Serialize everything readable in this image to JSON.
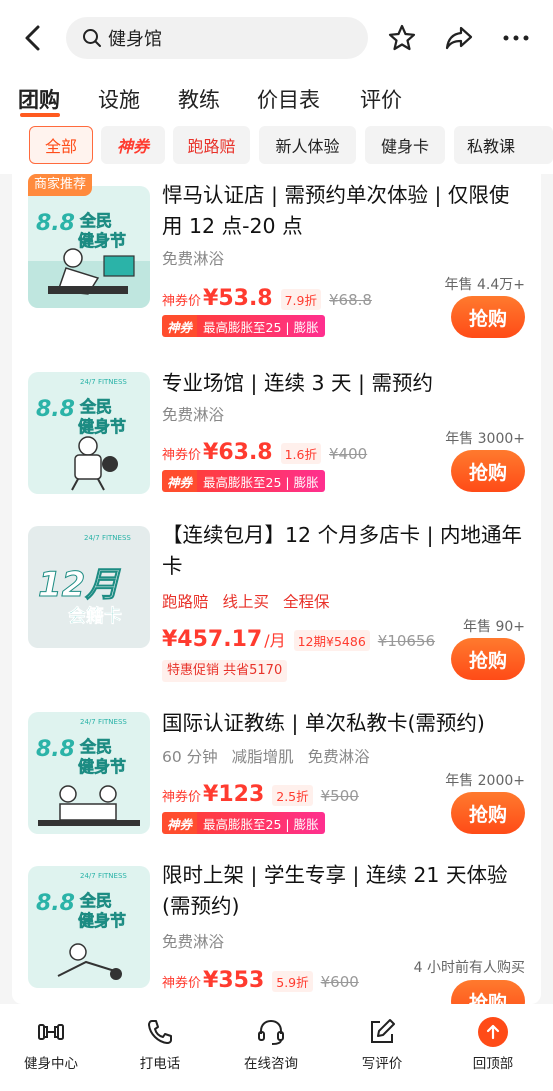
{
  "search": {
    "query": "健身馆"
  },
  "tabs": [
    {
      "label": "团购"
    },
    {
      "label": "设施"
    },
    {
      "label": "教练"
    },
    {
      "label": "价目表"
    },
    {
      "label": "评价"
    }
  ],
  "chips": [
    {
      "label": "全部"
    },
    {
      "label": "神券"
    },
    {
      "label": "跑路赔"
    },
    {
      "label": "新人体验"
    },
    {
      "label": "健身卡"
    },
    {
      "label": "私教课"
    }
  ],
  "items": [
    {
      "badge": "商家推荐",
      "title": "悍马认证店 | 需预约单次体验 | 仅限使用 12 点-20 点",
      "tags": [
        "免费淋浴"
      ],
      "price_label": "神券价",
      "price": "¥53.8",
      "discount": "7.9折",
      "original": "¥68.8",
      "promo_tag": "神券",
      "promo_text": "最高膨胀至25 | 膨胀",
      "sold": "年售 4.4万+",
      "buy": "抢购",
      "poster": {
        "top": "8.8",
        "line1": "全民",
        "line2": "健身节"
      }
    },
    {
      "title": "专业场馆 | 连续 3 天 | 需预约",
      "tags": [
        "免费淋浴"
      ],
      "price_label": "神券价",
      "price": "¥63.8",
      "discount": "1.6折",
      "original": "¥400",
      "promo_tag": "神券",
      "promo_text": "最高膨胀至25 | 膨胀",
      "sold": "年售 3000+",
      "buy": "抢购",
      "poster": {
        "brand": "24/7 FITNESS",
        "top": "8.8",
        "line1": "全民",
        "line2": "健身节"
      }
    },
    {
      "title": "【连续包月】12 个月多店卡 | 内地通年卡",
      "tags": [
        "跑路赔",
        "线上买",
        "全程保"
      ],
      "price": "¥457.17",
      "unit": "/月",
      "discount": "12期¥5486",
      "original": "¥10656",
      "promo_text": "特惠促销  共省5170",
      "sold": "年售 90+",
      "buy": "抢购",
      "poster": {
        "brand": "24/7 FITNESS",
        "top": "12月",
        "line1": "会籍卡"
      }
    },
    {
      "title": "国际认证教练 | 单次私教卡(需预约)",
      "tags": [
        "60 分钟",
        "减脂增肌",
        "免费淋浴"
      ],
      "price_label": "神券价",
      "price": "¥123",
      "discount": "2.5折",
      "original": "¥500",
      "promo_tag": "神券",
      "promo_text": "最高膨胀至25 | 膨胀",
      "sold": "年售 2000+",
      "buy": "抢购",
      "poster": {
        "brand": "24/7 FITNESS",
        "top": "8.8",
        "line1": "全民",
        "line2": "健身节"
      }
    },
    {
      "title": "限时上架 | 学生专享 | 连续 21 天体验(需预约)",
      "tags": [
        "免费淋浴"
      ],
      "price_label": "神券价",
      "price": "¥353",
      "discount": "5.9折",
      "original": "¥600",
      "sold": "4 小时前有人购买",
      "buy": "抢购",
      "poster": {
        "brand": "24/7 FITNESS",
        "top": "8.8",
        "line1": "全民",
        "line2": "健身节"
      }
    }
  ],
  "bottom_bar": [
    {
      "label": "健身中心",
      "icon": "dumbbell-icon"
    },
    {
      "label": "打电话",
      "icon": "phone-icon"
    },
    {
      "label": "在线咨询",
      "icon": "headset-icon"
    },
    {
      "label": "写评价",
      "icon": "edit-icon"
    },
    {
      "label": "回顶部",
      "icon": "arrow-up-icon"
    }
  ],
  "colors": {
    "accent": "#ff4b17",
    "price": "#ff3b2f",
    "poster_teal": "#2bb3a8"
  }
}
